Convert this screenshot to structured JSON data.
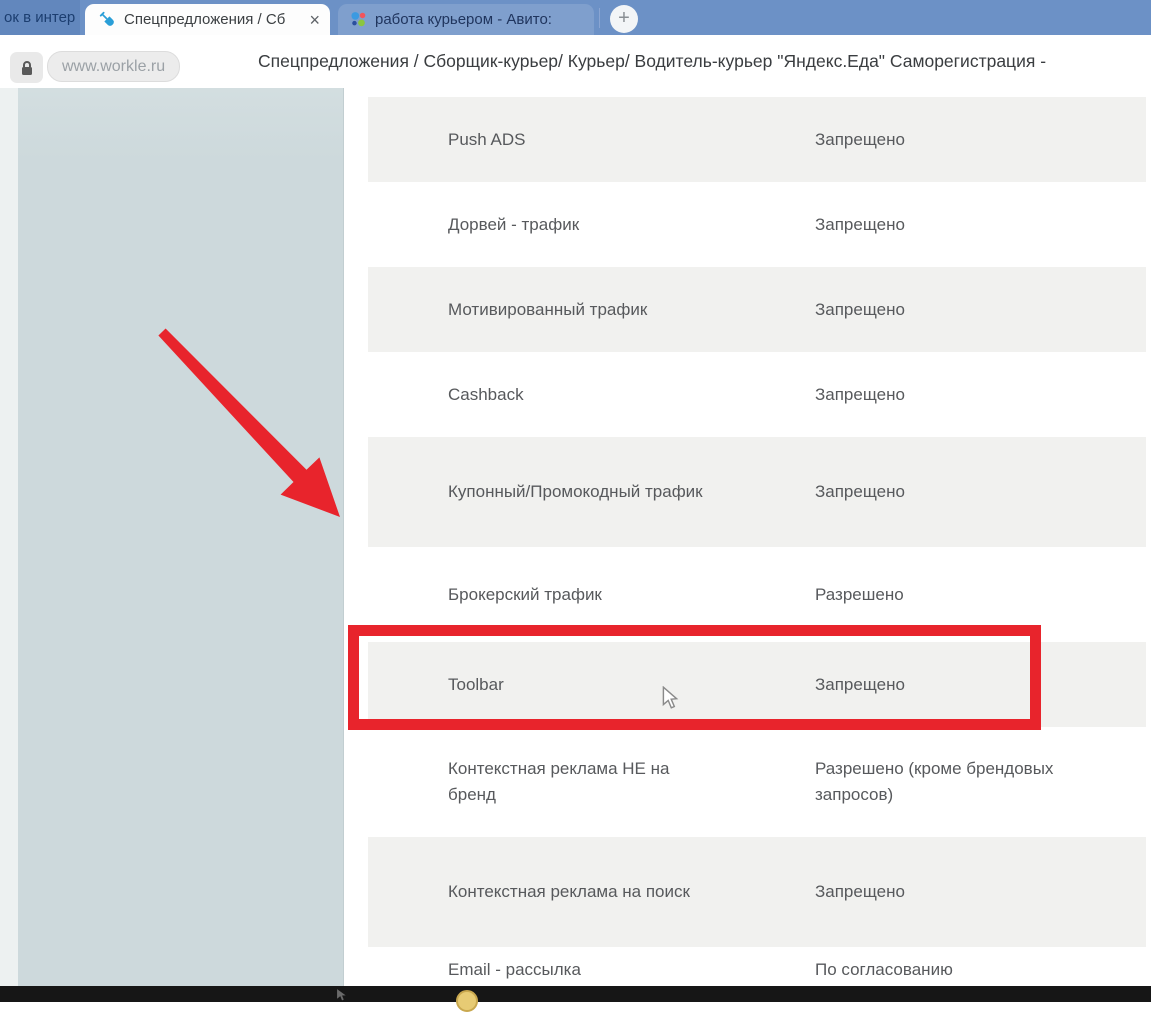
{
  "browser": {
    "partial_tab": {
      "label": "ок в интер"
    },
    "active_tab": {
      "label": "Спецпредложения / Сб",
      "close_label": "×",
      "favicon": "workle-shovel-icon"
    },
    "second_tab": {
      "label": "работа курьером - Авито:",
      "favicon": "avito-dots-icon"
    },
    "new_tab_label": "+",
    "url": "www.workle.ru",
    "page_title": "Спецпредложения / Сборщик-курьер/ Курьер/ Водитель-курьер \"Яндекс.Еда\" Саморегистрация -"
  },
  "table": {
    "rows": [
      {
        "label": "Push ADS",
        "status": "Запрещено"
      },
      {
        "label": "Дорвей - трафик",
        "status": "Запрещено"
      },
      {
        "label": "Мотивированный трафик",
        "status": "Запрещено"
      },
      {
        "label": "Cashback",
        "status": "Запрещено"
      },
      {
        "label": "Купонный/Промокодный трафик",
        "status": "Запрещено"
      },
      {
        "label": "Брокерский трафик",
        "status": "Разрешено",
        "highlighted": true
      },
      {
        "label": "Toolbar",
        "status": "Запрещено"
      },
      {
        "label": "Контекстная реклама НЕ на бренд",
        "status": "Разрешено (кроме брендовых запросов)"
      },
      {
        "label": "Контекстная реклама на поиск",
        "status": "Запрещено"
      },
      {
        "label": "Email - рассылка",
        "status": "По согласованию"
      }
    ]
  },
  "annotations": {
    "highlight_color": "#e8242c",
    "arrow_color": "#e8242c",
    "row_gray": "#f1f1ef",
    "row_white": "#ffffff"
  }
}
